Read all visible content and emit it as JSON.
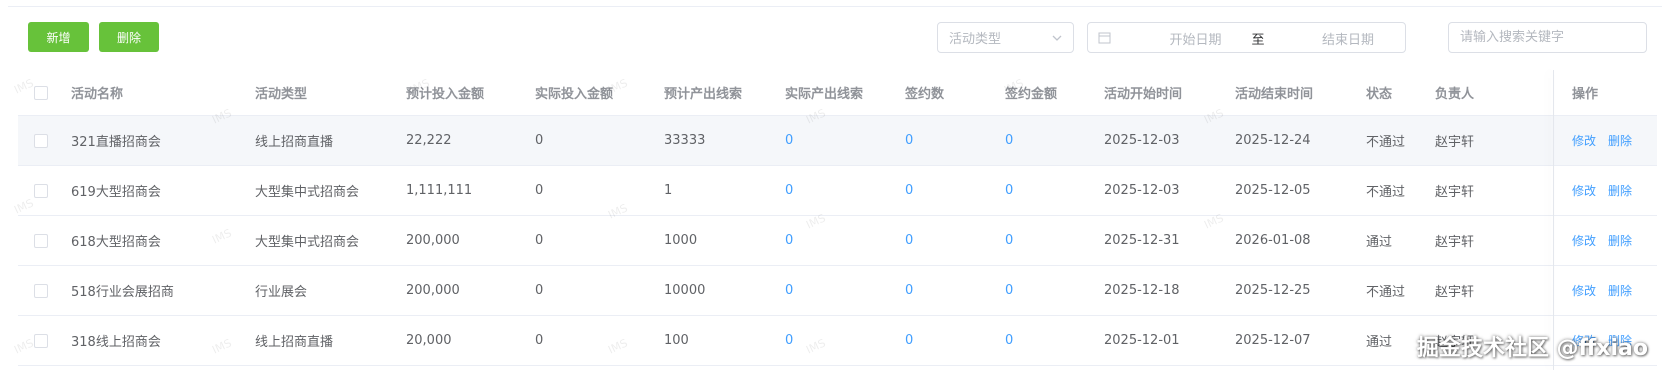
{
  "toolbar": {
    "add_label": "新增",
    "delete_label": "删除"
  },
  "filters": {
    "activity_type_placeholder": "活动类型",
    "start_date_placeholder": "开始日期",
    "range_separator": "至",
    "end_date_placeholder": "结束日期",
    "search_placeholder": "请输入搜索关键字"
  },
  "table": {
    "columns": [
      "活动名称",
      "活动类型",
      "预计投入金额",
      "实际投入金额",
      "预计产出线索",
      "实际产出线索",
      "签约数",
      "签约金额",
      "活动开始时间",
      "活动结束时间",
      "状态",
      "负责人",
      "操作"
    ],
    "action_edit": "修改",
    "action_delete": "删除",
    "rows": [
      [
        "321直播招商会",
        "线上招商直播",
        "22,222",
        "0",
        "33333",
        "0",
        "0",
        "0",
        "2025-12-03",
        "2025-12-24",
        "不通过",
        "赵宇轩"
      ],
      [
        "619大型招商会",
        "大型集中式招商会",
        "1,111,111",
        "0",
        "1",
        "0",
        "0",
        "0",
        "2025-12-03",
        "2025-12-05",
        "不通过",
        "赵宇轩"
      ],
      [
        "618大型招商会",
        "大型集中式招商会",
        "200,000",
        "0",
        "1000",
        "0",
        "0",
        "0",
        "2025-12-31",
        "2026-01-08",
        "通过",
        "赵宇轩"
      ],
      [
        "518行业会展招商",
        "行业展会",
        "200,000",
        "0",
        "10000",
        "0",
        "0",
        "0",
        "2025-12-18",
        "2025-12-25",
        "不通过",
        "赵宇轩"
      ],
      [
        "318线上招商会",
        "线上招商直播",
        "20,000",
        "0",
        "100",
        "0",
        "0",
        "0",
        "2025-12-01",
        "2025-12-07",
        "通过",
        "赵宇轩"
      ]
    ]
  },
  "watermarks": {
    "tile_text": "IMS",
    "site_mark": "掘金技术社区 @ffxiao"
  },
  "colors": {
    "primary_button": "#67c23a",
    "link": "#409eff",
    "header_text": "#909399",
    "row_hover": "#f5f7fa"
  }
}
